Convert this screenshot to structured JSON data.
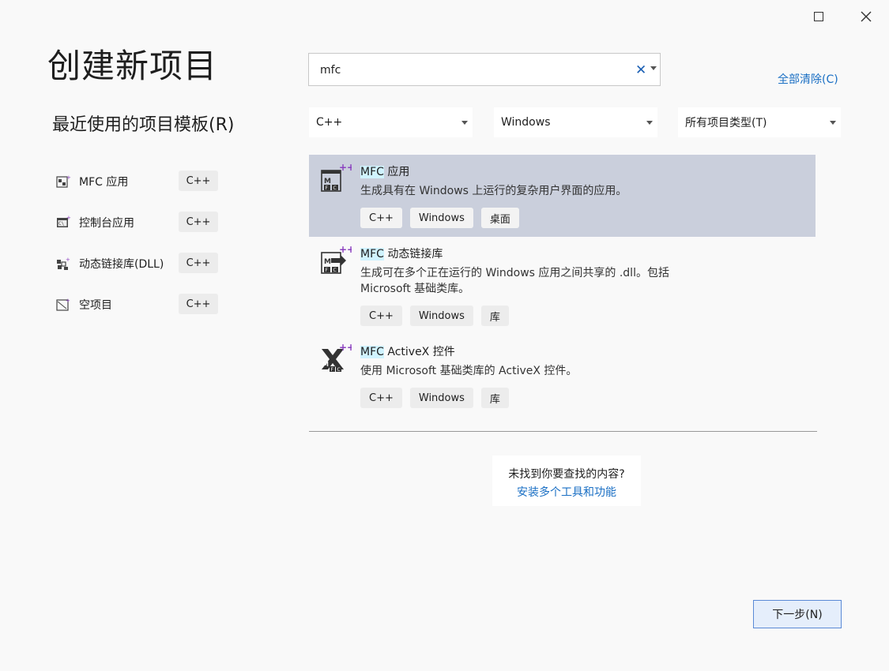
{
  "window": {
    "maximize_icon": "maximize-icon",
    "close_icon": "close-icon"
  },
  "page_title": "创建新项目",
  "recent": {
    "title": "最近使用的项目模板(R)",
    "items": [
      {
        "label": "MFC 应用",
        "tag": "C++",
        "icon": "mfc-app-icon"
      },
      {
        "label": "控制台应用",
        "tag": "C++",
        "icon": "console-app-icon"
      },
      {
        "label": "动态链接库(DLL)",
        "tag": "C++",
        "icon": "dll-icon"
      },
      {
        "label": "空项目",
        "tag": "C++",
        "icon": "empty-project-icon"
      }
    ]
  },
  "search": {
    "value": "mfc",
    "clear_glyph": "✕"
  },
  "clear_all": "全部清除(C)",
  "filters": {
    "language": "C++",
    "platform": "Windows",
    "project_type": "所有项目类型(T)"
  },
  "results": [
    {
      "match": "MFC",
      "name_rest": " 应用",
      "desc": "生成具有在 Windows 上运行的复杂用户界面的应用。",
      "tags": [
        "C++",
        "Windows",
        "桌面"
      ],
      "selected": true
    },
    {
      "match": "MFC",
      "name_rest": " 动态链接库",
      "desc": "生成可在多个正在运行的 Windows 应用之间共享的 .dll。包括 Microsoft 基础类库。",
      "tags": [
        "C++",
        "Windows",
        "库"
      ],
      "selected": false
    },
    {
      "match": "MFC",
      "name_rest": " ActiveX 控件",
      "desc": "使用 Microsoft 基础类库的 ActiveX 控件。",
      "tags": [
        "C++",
        "Windows",
        "库"
      ],
      "selected": false
    }
  ],
  "not_found": {
    "question": "未找到你要查找的内容?",
    "link": "安装多个工具和功能"
  },
  "next_button": "下一步(N)",
  "colors": {
    "accent": "#1a6fc4",
    "selected_bg": "#cacfdc",
    "highlight": "#d0f3ff"
  }
}
